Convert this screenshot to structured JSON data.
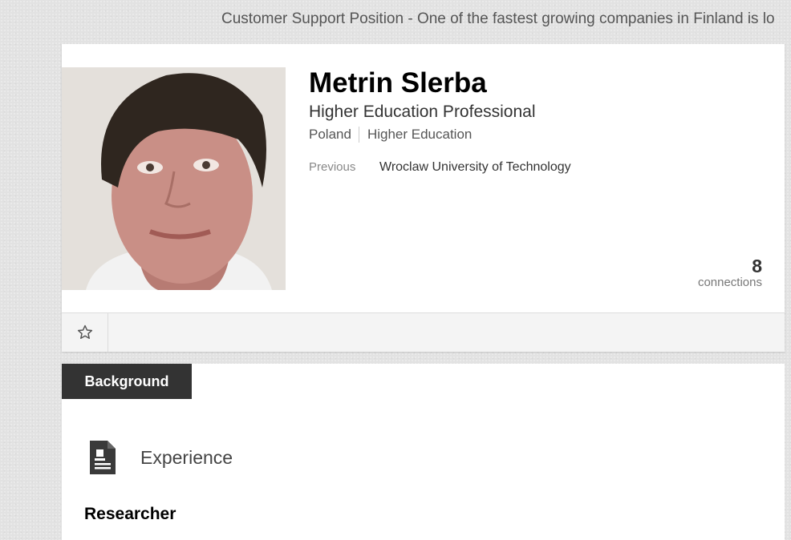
{
  "ticker": {
    "text": "Customer Support Position - One of the fastest growing companies in Finland is lo"
  },
  "profile": {
    "name": "Metrin Slerba",
    "headline": "Higher Education Professional",
    "location": "Poland",
    "industry": "Higher Education",
    "previous_label": "Previous",
    "previous_value": "Wroclaw University of Technology",
    "connections_count": "8",
    "connections_label": "connections"
  },
  "actions": {
    "star_icon": "star-outline-icon"
  },
  "background": {
    "tab_label": "Background",
    "section_icon": "resume-icon",
    "section_title": "Experience",
    "first_job_title": "Researcher"
  },
  "colors": {
    "tab_bg": "#333333",
    "page_bg": "#e2e2e2",
    "card_bg": "#ffffff"
  }
}
